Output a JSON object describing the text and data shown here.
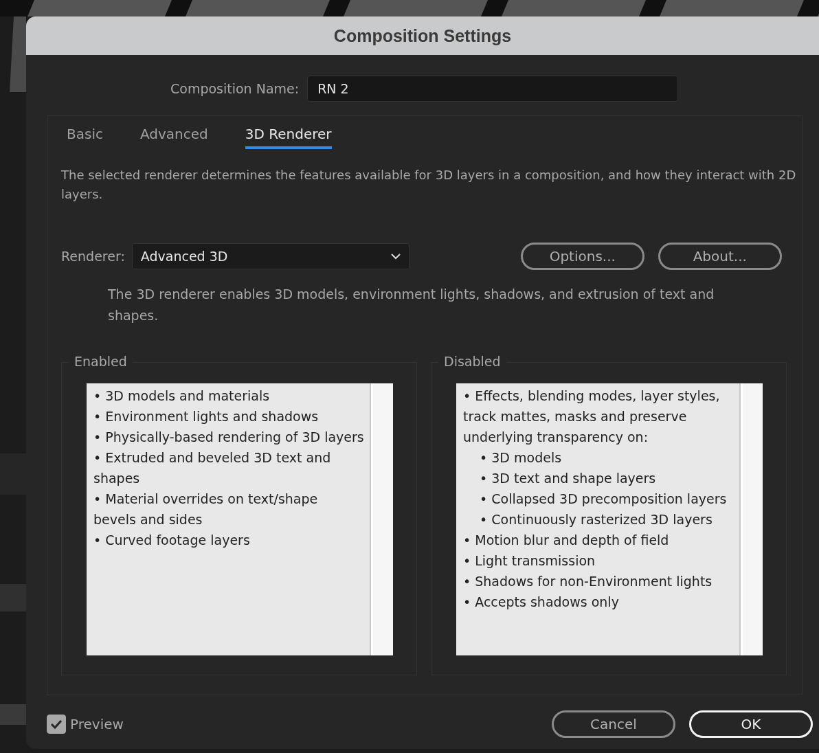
{
  "window": {
    "title": "Composition Settings"
  },
  "composition_name": {
    "label": "Composition Name:",
    "value": "RN 2"
  },
  "tabs": [
    {
      "label": "Basic",
      "selected": false
    },
    {
      "label": "Advanced",
      "selected": false
    },
    {
      "label": "3D Renderer",
      "selected": true
    }
  ],
  "description": "The selected renderer determines the features available for 3D layers in a composition, and how they interact with 2D layers.",
  "renderer": {
    "label": "Renderer:",
    "value": "Advanced 3D",
    "buttons": [
      "Options...",
      "About..."
    ],
    "note": "The 3D renderer enables 3D models, environment lights, shadows, and extrusion of text and shapes."
  },
  "groups": [
    {
      "title": "Enabled",
      "items": [
        {
          "text": "• 3D models and materials"
        },
        {
          "text": "• Environment lights and shadows"
        },
        {
          "text": "• Physically-based rendering of 3D layers"
        },
        {
          "text": "• Extruded and beveled 3D text and shapes"
        },
        {
          "text": "• Material overrides on text/shape bevels and sides"
        },
        {
          "text": "• Curved footage layers"
        }
      ]
    },
    {
      "title": "Disabled",
      "items": [
        {
          "text": "• Effects, blending modes, layer styles, track mattes, masks and preserve underlying transparency on:",
          "children": [
            {
              "text": "• 3D models"
            },
            {
              "text": "• 3D text and shape layers"
            },
            {
              "text": "• Collapsed 3D precomposition layers"
            },
            {
              "text": "• Continuously rasterized 3D layers"
            }
          ]
        },
        {
          "text": "• Motion blur and depth of field"
        },
        {
          "text": "• Light transmission"
        },
        {
          "text": "• Shadows for non-Environment lights"
        },
        {
          "text": "• Accepts shadows only"
        }
      ]
    }
  ],
  "preview": {
    "label": "Preview",
    "checked": true
  },
  "buttons": [
    {
      "label": "Cancel",
      "kind": "secondary"
    },
    {
      "label": "OK",
      "kind": "primary"
    }
  ]
}
